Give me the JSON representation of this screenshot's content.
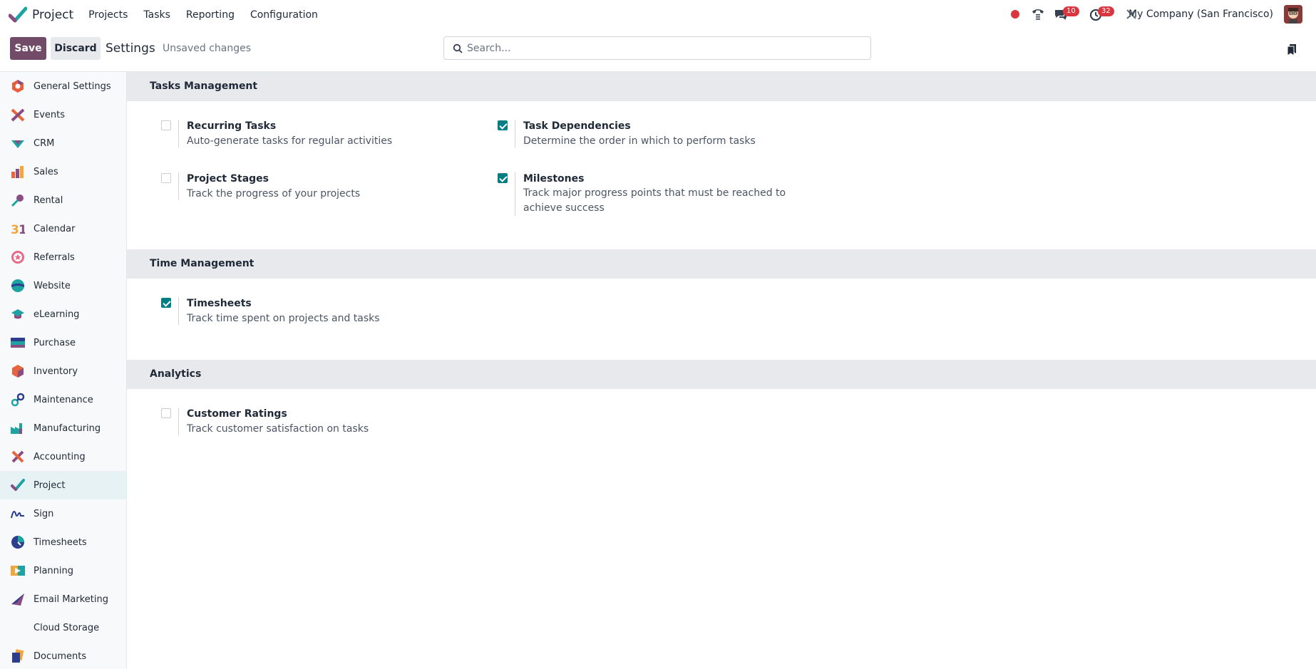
{
  "navbar": {
    "app_name": "Project",
    "menu": [
      "Projects",
      "Tasks",
      "Reporting",
      "Configuration"
    ],
    "messages_count": "10",
    "activities_count": "32",
    "company": "My Company (San Francisco)"
  },
  "control_panel": {
    "save_label": "Save",
    "discard_label": "Discard",
    "title": "Settings",
    "status": "Unsaved changes",
    "search_placeholder": "Search..."
  },
  "sidebar": {
    "items": [
      {
        "label": "General Settings",
        "icon": "general-settings-icon"
      },
      {
        "label": "Events",
        "icon": "events-icon"
      },
      {
        "label": "CRM",
        "icon": "crm-icon"
      },
      {
        "label": "Sales",
        "icon": "sales-icon"
      },
      {
        "label": "Rental",
        "icon": "rental-icon"
      },
      {
        "label": "Calendar",
        "icon": "calendar-icon"
      },
      {
        "label": "Referrals",
        "icon": "referrals-icon"
      },
      {
        "label": "Website",
        "icon": "website-icon"
      },
      {
        "label": "eLearning",
        "icon": "elearning-icon"
      },
      {
        "label": "Purchase",
        "icon": "purchase-icon"
      },
      {
        "label": "Inventory",
        "icon": "inventory-icon"
      },
      {
        "label": "Maintenance",
        "icon": "maintenance-icon"
      },
      {
        "label": "Manufacturing",
        "icon": "manufacturing-icon"
      },
      {
        "label": "Accounting",
        "icon": "accounting-icon"
      },
      {
        "label": "Project",
        "icon": "project-icon"
      },
      {
        "label": "Sign",
        "icon": "sign-icon"
      },
      {
        "label": "Timesheets",
        "icon": "timesheets-icon"
      },
      {
        "label": "Planning",
        "icon": "planning-icon"
      },
      {
        "label": "Email Marketing",
        "icon": "email-marketing-icon"
      },
      {
        "label": "Cloud Storage",
        "icon": ""
      },
      {
        "label": "Documents",
        "icon": "documents-icon"
      }
    ],
    "active": "Project"
  },
  "sections": {
    "tasks_management": {
      "title": "Tasks Management",
      "recurring": {
        "title": "Recurring Tasks",
        "desc": "Auto-generate tasks for regular activities",
        "checked": false
      },
      "dependencies": {
        "title": "Task Dependencies",
        "desc": "Determine the order in which to perform tasks",
        "checked": true
      },
      "stages": {
        "title": "Project Stages",
        "desc": "Track the progress of your projects",
        "checked": false
      },
      "milestones": {
        "title": "Milestones",
        "desc": "Track major progress points that must be reached to achieve success",
        "checked": true
      }
    },
    "time_management": {
      "title": "Time Management",
      "timesheets": {
        "title": "Timesheets",
        "desc": "Track time spent on projects and tasks",
        "checked": true
      }
    },
    "analytics": {
      "title": "Analytics",
      "ratings": {
        "title": "Customer Ratings",
        "desc": "Track customer satisfaction on tasks",
        "checked": false
      }
    }
  },
  "colors": {
    "primary": "#714b67",
    "accent": "#017e84",
    "badge": "#d9363e"
  }
}
